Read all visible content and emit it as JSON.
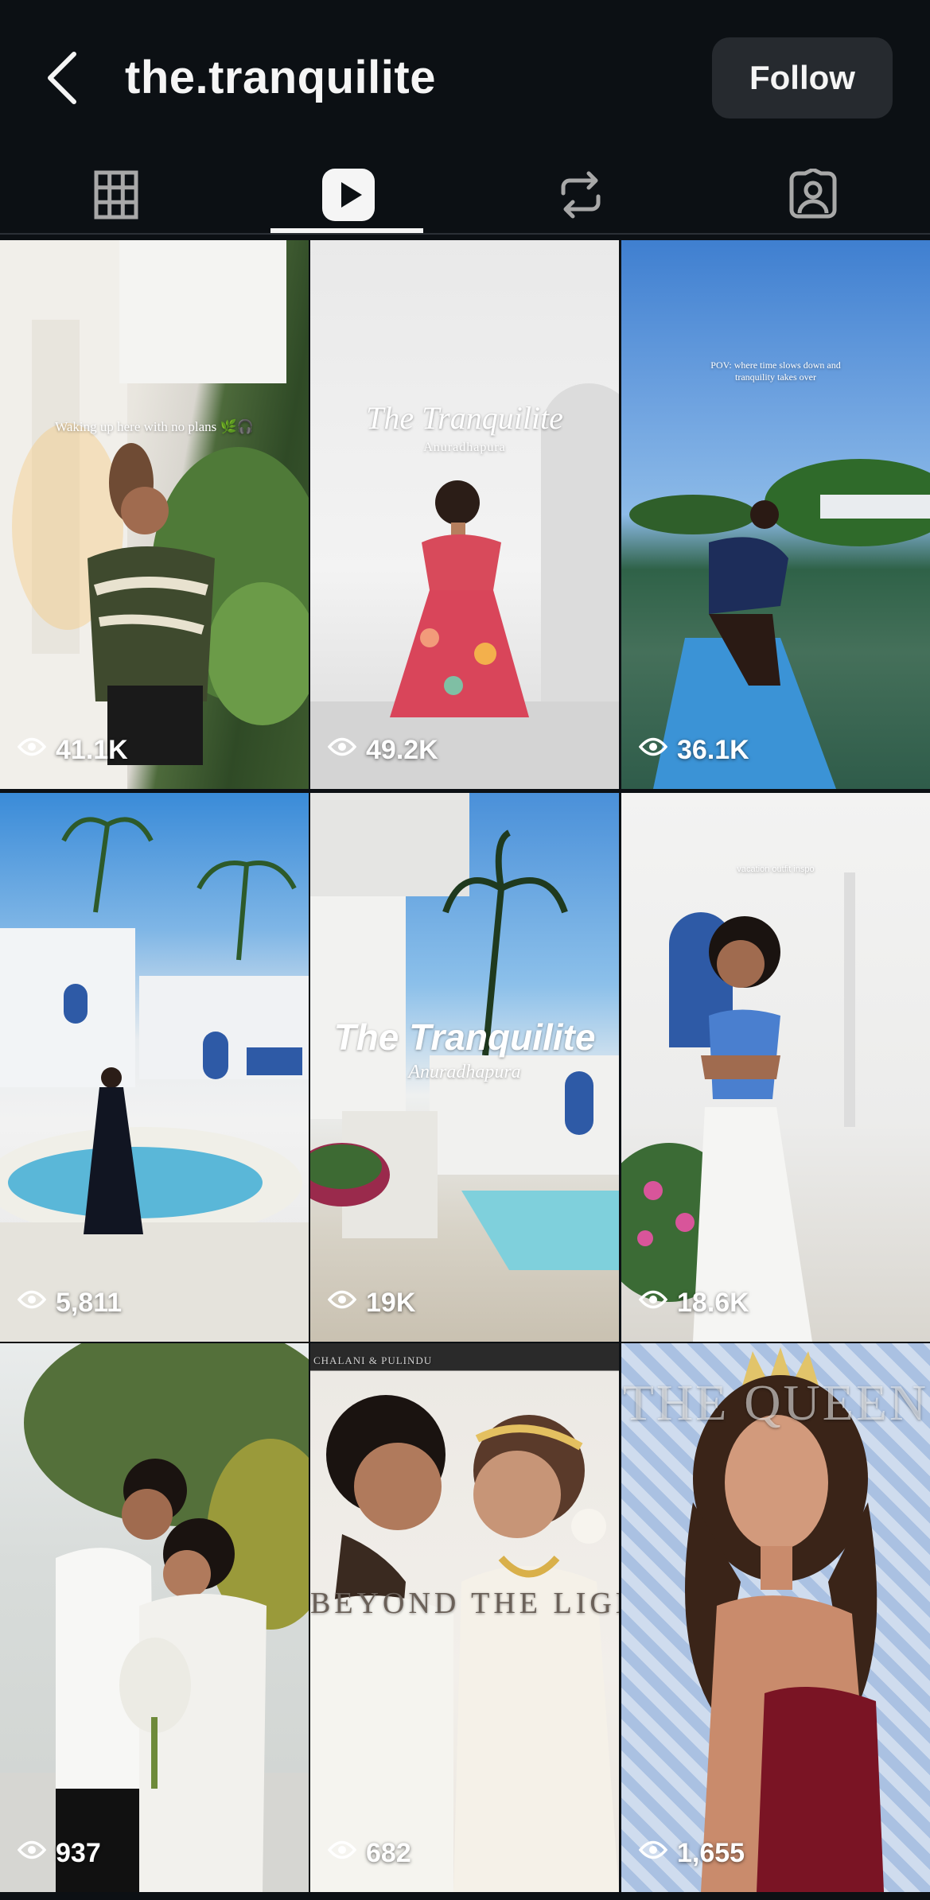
{
  "header": {
    "title": "the.tranquilite",
    "follow_label": "Follow"
  },
  "tabs": [
    {
      "icon": "grid-icon"
    },
    {
      "icon": "reels-icon",
      "selected": true
    },
    {
      "icon": "reposts-icon"
    },
    {
      "icon": "tagged-icon"
    }
  ],
  "reels": [
    {
      "views": "41.1K",
      "caption": "Waking up here with no plans 🌿🎧"
    },
    {
      "views": "49.2K",
      "title": "The Tranquilite",
      "subtitle": "Anuradhapura"
    },
    {
      "views": "36.1K",
      "caption": "POV: where time slows down and tranquility takes over"
    },
    {
      "views": "5,811"
    },
    {
      "views": "19K",
      "title": "The Tranquilite",
      "subtitle": "Anuradhapura"
    },
    {
      "views": "18.6K",
      "caption": "vacation outfit inspo"
    },
    {
      "views": "937"
    },
    {
      "views": "682",
      "top_text": "CHALANI & PULINDU",
      "mid_text": "BEYOND THE LIGHT"
    },
    {
      "views": "1,655",
      "bg_text": "THE QUEEN"
    }
  ],
  "colors": {
    "background": "#0c1014",
    "follow_button": "#262a2f",
    "text": "#f5f5f5"
  }
}
